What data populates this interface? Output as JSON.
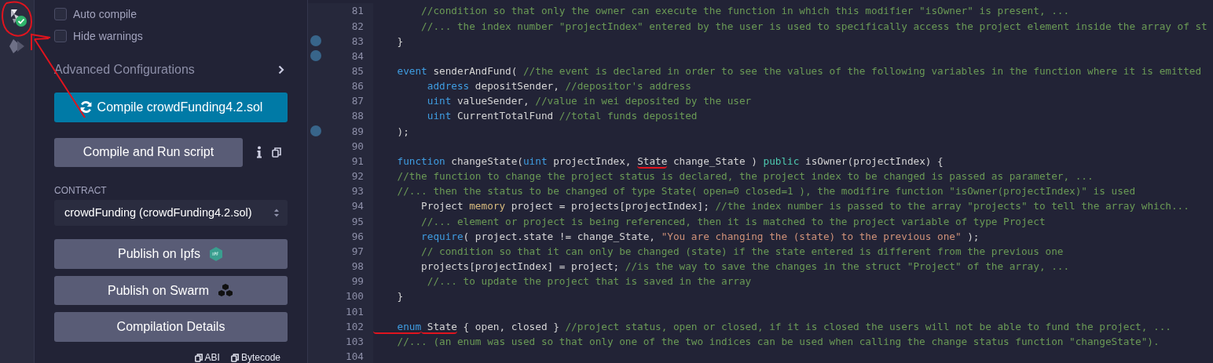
{
  "icon_bar": {
    "items": [
      {
        "kind": "compiler",
        "selected": true
      },
      {
        "kind": "deploy",
        "selected": false
      }
    ]
  },
  "compiler_panel": {
    "options": [
      {
        "label": "Auto compile",
        "checked": false
      },
      {
        "label": "Hide warnings",
        "checked": false
      }
    ],
    "advanced": {
      "label": "Advanced Configurations",
      "expanded": false
    },
    "compile_button": "Compile crowdFunding4.2.sol",
    "run_button": "Compile and Run script",
    "contract": {
      "label": "CONTRACT",
      "value": "crowdFunding (crowdFunding4.2.sol)"
    },
    "publish_buttons": [
      {
        "label": "Publish on Ipfs",
        "kind": "ipfs"
      },
      {
        "label": "Publish on Swarm",
        "kind": "swarm"
      },
      {
        "label": "Compilation Details",
        "kind": "plain"
      }
    ],
    "copy_links": [
      "ABI",
      "Bytecode"
    ]
  },
  "editor": {
    "lines": [
      {
        "number": "81",
        "breakpoint": false,
        "tokens": [
          {
            "kind": "comment",
            "underlined": false,
            "text": "        //condition so that only the owner can execute the function in which this modifier \"isOwner\" is present, ..."
          }
        ]
      },
      {
        "number": "82",
        "breakpoint": false,
        "tokens": [
          {
            "kind": "comment",
            "underlined": false,
            "text": "        //... the index number \"projectIndex\" entered by the user is used to specifically access the project element inside the array of st"
          }
        ]
      },
      {
        "number": "83",
        "breakpoint": true,
        "tokens": [
          {
            "kind": "plain",
            "underlined": false,
            "text": "    }"
          }
        ]
      },
      {
        "number": "84",
        "breakpoint": true
      },
      {
        "number": "85",
        "breakpoint": false,
        "tokens": [
          {
            "kind": "keyword",
            "underlined": false,
            "text": "    event"
          },
          {
            "kind": "plain",
            "underlined": false,
            "text": " senderAndFund( "
          },
          {
            "kind": "comment",
            "underlined": false,
            "text": "//the event is declared in order to see the values of the following variables in the function where it is emitted"
          }
        ]
      },
      {
        "number": "86",
        "breakpoint": false,
        "tokens": [
          {
            "kind": "keyword",
            "underlined": false,
            "text": "         address"
          },
          {
            "kind": "plain",
            "underlined": false,
            "text": " depositSender, "
          },
          {
            "kind": "comment",
            "underlined": false,
            "text": "//depositor's address"
          }
        ]
      },
      {
        "number": "87",
        "breakpoint": false,
        "tokens": [
          {
            "kind": "keyword",
            "underlined": false,
            "text": "         uint"
          },
          {
            "kind": "plain",
            "underlined": false,
            "text": " valueSender, "
          },
          {
            "kind": "comment",
            "underlined": false,
            "text": "//value in wei deposited by the user"
          }
        ]
      },
      {
        "number": "88",
        "breakpoint": false,
        "tokens": [
          {
            "kind": "keyword",
            "underlined": false,
            "text": "         uint"
          },
          {
            "kind": "plain",
            "underlined": false,
            "text": " CurrentTotalFund "
          },
          {
            "kind": "comment",
            "underlined": false,
            "text": "//total funds deposited"
          }
        ]
      },
      {
        "number": "89",
        "breakpoint": true,
        "tokens": [
          {
            "kind": "plain",
            "underlined": false,
            "text": "    );"
          }
        ]
      },
      {
        "number": "90",
        "breakpoint": false
      },
      {
        "number": "91",
        "breakpoint": false,
        "tokens": [
          {
            "kind": "keyword",
            "underlined": false,
            "text": "    function"
          },
          {
            "kind": "plain",
            "underlined": false,
            "text": " changeState("
          },
          {
            "kind": "keyword",
            "underlined": false,
            "text": "uint"
          },
          {
            "kind": "plain",
            "underlined": false,
            "text": " projectIndex, "
          },
          {
            "kind": "plain",
            "underlined": true,
            "text": "State"
          },
          {
            "kind": "plain",
            "underlined": false,
            "text": " change_State ) "
          },
          {
            "kind": "modifier",
            "underlined": false,
            "text": "public"
          },
          {
            "kind": "plain",
            "underlined": false,
            "text": " isOwner(projectIndex) {"
          }
        ]
      },
      {
        "number": "92",
        "breakpoint": false,
        "tokens": [
          {
            "kind": "comment",
            "underlined": false,
            "text": "    //the function to change the project status is declared, the project index to be changed is passed as parameter, ..."
          }
        ]
      },
      {
        "number": "93",
        "breakpoint": false,
        "tokens": [
          {
            "kind": "comment",
            "underlined": false,
            "text": "    //... then the status to be changed of type State( open=0 closed=1 ), the modifire function \"isOwner(projectIndex)\" is used"
          }
        ]
      },
      {
        "number": "94",
        "breakpoint": false,
        "tokens": [
          {
            "kind": "plain",
            "underlined": false,
            "text": "        Project "
          },
          {
            "kind": "storage",
            "underlined": false,
            "text": "memory"
          },
          {
            "kind": "plain",
            "underlined": false,
            "text": " project = projects[projectIndex]; "
          },
          {
            "kind": "comment",
            "underlined": false,
            "text": "//the index number is passed to the array \"projects\" to tell the array which..."
          }
        ]
      },
      {
        "number": "95",
        "breakpoint": false,
        "tokens": [
          {
            "kind": "comment",
            "underlined": false,
            "text": "        //... element or project is being referenced, then it is matched to the project variable of type Project"
          }
        ]
      },
      {
        "number": "96",
        "breakpoint": false,
        "tokens": [
          {
            "kind": "keyword",
            "underlined": false,
            "text": "        require"
          },
          {
            "kind": "plain",
            "underlined": false,
            "text": "( project.state != change_State, "
          },
          {
            "kind": "string",
            "underlined": false,
            "text": "\"You are changing the (state) to the previous one\""
          },
          {
            "kind": "plain",
            "underlined": false,
            "text": " );"
          }
        ]
      },
      {
        "number": "97",
        "breakpoint": false,
        "tokens": [
          {
            "kind": "comment",
            "underlined": false,
            "text": "        // condition so that it can only be changed (state) if the state entered is different from the previous one"
          }
        ]
      },
      {
        "number": "98",
        "breakpoint": false,
        "tokens": [
          {
            "kind": "plain",
            "underlined": false,
            "text": "        projects[projectIndex] = project; "
          },
          {
            "kind": "comment",
            "underlined": false,
            "text": "//is the way to save the changes in the struct \"Project\" of the array, ..."
          }
        ]
      },
      {
        "number": "99",
        "breakpoint": false,
        "tokens": [
          {
            "kind": "comment",
            "underlined": false,
            "text": "         //... to update the project that is saved in the array"
          }
        ]
      },
      {
        "number": "100",
        "breakpoint": false,
        "tokens": [
          {
            "kind": "plain",
            "underlined": false,
            "text": "    }"
          }
        ]
      },
      {
        "number": "101",
        "breakpoint": false
      },
      {
        "number": "102",
        "breakpoint": false,
        "tokens": [
          {
            "kind": "keyword",
            "underlined": true,
            "text": "    enum"
          },
          {
            "kind": "plain",
            "underlined": true,
            "text": " State"
          },
          {
            "kind": "plain",
            "underlined": false,
            "text": " { open, closed } "
          },
          {
            "kind": "comment",
            "underlined": false,
            "text": "//project status, open or closed, if it is closed the users will not be able to fund the project, ..."
          }
        ]
      },
      {
        "number": "103",
        "breakpoint": false,
        "tokens": [
          {
            "kind": "comment",
            "underlined": false,
            "text": "    //... (an enum was used so that only one of the two indices can be used when calling the change status function \"changeState\")."
          }
        ]
      },
      {
        "number": "104",
        "breakpoint": false
      }
    ]
  }
}
